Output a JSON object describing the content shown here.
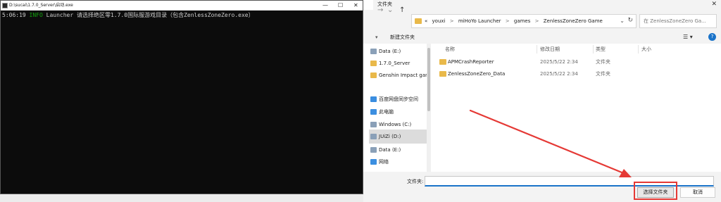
{
  "dialog": {
    "title": "文件夹",
    "close_glyph": "✕",
    "address": {
      "crumbs": [
        "«",
        "youxi",
        ">",
        "miHoYo Launcher",
        ">",
        "games",
        ">",
        "ZenlessZoneZero Game"
      ]
    },
    "search_placeholder": "在 ZenlessZoneZero Ga...",
    "toolbar": {
      "organize_arrow": "▾",
      "new_folder": "新建文件夹",
      "view_glyph": "☰ ▾",
      "help_glyph": "?"
    },
    "nav_pane": [
      {
        "label": "Data (E:)",
        "icon": "drive-icon"
      },
      {
        "label": "1.7.0_Server",
        "icon": "folder-icon"
      },
      {
        "label": "Genshin Impact gam",
        "icon": "folder-icon"
      },
      {
        "label": "百度网盘同步空间",
        "icon": "cloud-icon"
      },
      {
        "label": "此电脑",
        "icon": "pc-icon"
      },
      {
        "label": "Windows (C:)",
        "icon": "drive-icon"
      },
      {
        "label": "JUiZi (D:)",
        "icon": "drive-icon",
        "selected": true
      },
      {
        "label": "Data (E:)",
        "icon": "drive-icon"
      },
      {
        "label": "网络",
        "icon": "network-icon"
      }
    ],
    "columns": {
      "name": "名称",
      "modified": "修改日期",
      "type": "类型",
      "size": "大小"
    },
    "rows": [
      {
        "name": "APMCrashReporter",
        "modified": "2025/5/22 2:34",
        "type": "文件夹"
      },
      {
        "name": "ZenlessZoneZero_Data",
        "modified": "2025/5/22 2:34",
        "type": "文件夹"
      }
    ],
    "filename_label": "文件夹:",
    "select_button": "选择文件夹",
    "cancel_button": "取消"
  },
  "console": {
    "title": "D:\\sucai\\1.7.0_Server\\启动.exe",
    "min_glyph": "—",
    "max_glyph": "☐",
    "close_glyph": "✕",
    "line": {
      "time": "5:06:19",
      "level": "INFO",
      "message": "Launcher 请选择绝区零1.7.0国际服游戏目录（包含ZenlessZoneZero.exe）"
    }
  },
  "colors": {
    "console_bg": "#0c0c0c",
    "info_green": "#13a10e",
    "annotation_red": "#e53935",
    "accent_blue": "#1a73c9"
  }
}
